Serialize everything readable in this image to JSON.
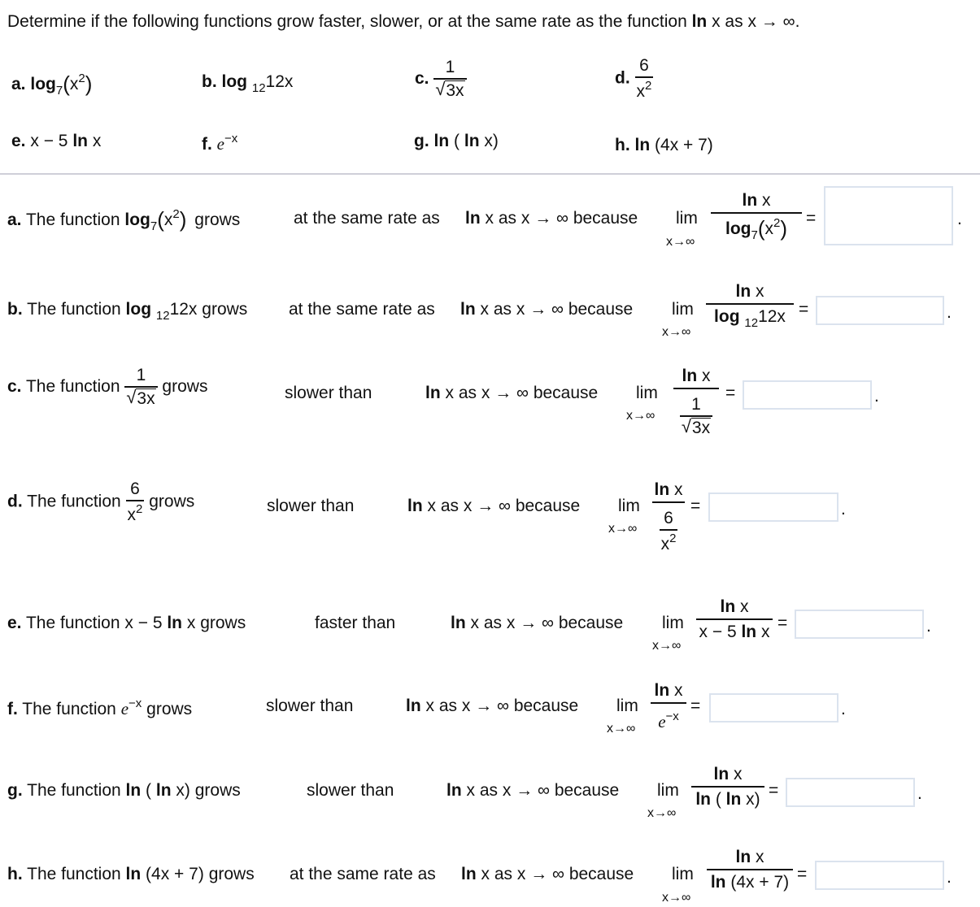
{
  "prompt": {
    "text_before": "Determine if the following functions grow faster, slower, or at the same rate as the function ",
    "ln": "ln",
    "text_after": " x as x → ∞."
  },
  "functions": {
    "a": {
      "label": "a.",
      "log": "log",
      "base": "7",
      "open": "(",
      "x": "x",
      "exp": "2",
      "close": ")"
    },
    "b": {
      "label": "b.",
      "log": "log",
      "base": "12",
      "arg": "12x"
    },
    "c": {
      "label": "c.",
      "num": "1",
      "den": "3x"
    },
    "d": {
      "label": "d.",
      "num": "6",
      "den": "x",
      "exp": "2"
    },
    "e": {
      "label": "e.",
      "pre": "x − 5 ",
      "ln": "ln",
      "post": " x"
    },
    "f": {
      "label": "f.",
      "base": "e",
      "exp": "−x"
    },
    "g": {
      "label": "g.",
      "ln1": "ln",
      "mid": " ( ",
      "ln2": "ln",
      "post": " x)"
    },
    "h": {
      "label": "h.",
      "ln": "ln",
      "post": " (4x + 7)"
    }
  },
  "common": {
    "the_function": " The function ",
    "grows": "grows",
    "ln": "ln",
    "as_x_inf": " x as x → ∞ because",
    "lim": "lim",
    "lim_under": "x→∞",
    "num_ln": "ln",
    "num_x": " x",
    "equals": "=",
    "period": "."
  },
  "parts": [
    {
      "id": "a",
      "label": "a.",
      "answer": "at the same rate as",
      "limit_value": ""
    },
    {
      "id": "b",
      "label": "b.",
      "answer": "at the same rate as",
      "limit_value": ""
    },
    {
      "id": "c",
      "label": "c.",
      "answer": "slower than",
      "limit_value": ""
    },
    {
      "id": "d",
      "label": "d.",
      "answer": "slower than",
      "limit_value": ""
    },
    {
      "id": "e",
      "label": "e.",
      "answer": "faster than",
      "limit_value": ""
    },
    {
      "id": "f",
      "label": "f.",
      "answer": "slower than",
      "limit_value": ""
    },
    {
      "id": "g",
      "label": "g.",
      "answer": "slower than",
      "limit_value": ""
    },
    {
      "id": "h",
      "label": "h.",
      "answer": "at the same rate as",
      "limit_value": ""
    }
  ]
}
